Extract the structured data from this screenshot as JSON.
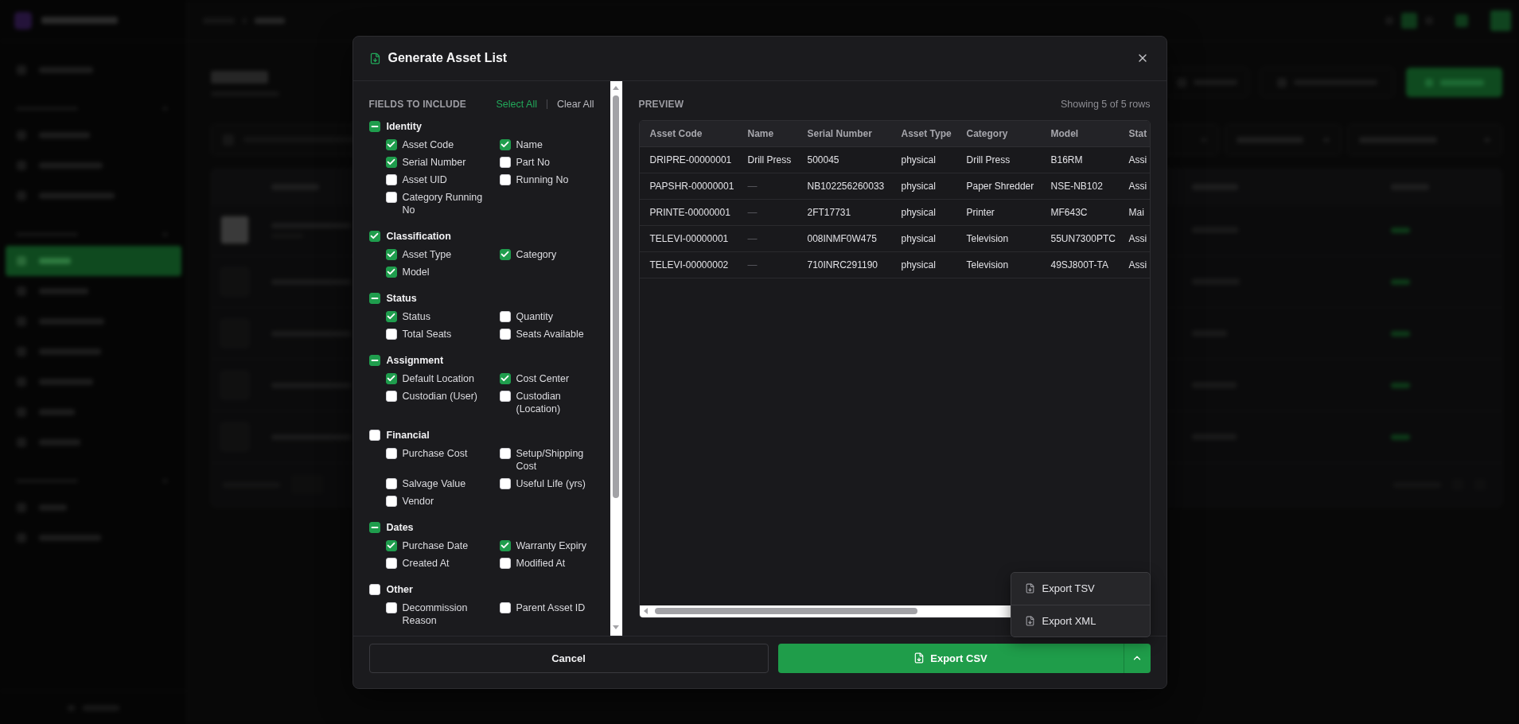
{
  "dialog": {
    "title": "Generate Asset List"
  },
  "fields_panel": {
    "heading": "FIELDS TO INCLUDE",
    "actions": [
      {
        "label": "Select All",
        "kind": "primary"
      },
      {
        "label": "Clear All",
        "kind": "secondary"
      }
    ],
    "groups": [
      {
        "label": "Identity",
        "checked": true,
        "fields": [
          {
            "label": "Asset Code",
            "checked": true
          },
          {
            "label": "Name",
            "checked": true
          },
          {
            "label": "Serial Number",
            "checked": true
          },
          {
            "label": "Part No",
            "checked": false
          },
          {
            "label": "Asset UID",
            "checked": false
          },
          {
            "label": "Running No",
            "checked": false
          },
          {
            "label": "Category Running No",
            "checked": false
          }
        ]
      },
      {
        "label": "Classification",
        "checked": true,
        "fields": [
          {
            "label": "Asset Type",
            "checked": true
          },
          {
            "label": "Category",
            "checked": true
          },
          {
            "label": "Model",
            "checked": true
          }
        ]
      },
      {
        "label": "Status",
        "checked": true,
        "fields": [
          {
            "label": "Status",
            "checked": true
          },
          {
            "label": "Quantity",
            "checked": false
          },
          {
            "label": "Total Seats",
            "checked": false
          },
          {
            "label": "Seats Available",
            "checked": false
          }
        ]
      },
      {
        "label": "Assignment",
        "checked": true,
        "fields": [
          {
            "label": "Default Location",
            "checked": true
          },
          {
            "label": "Cost Center",
            "checked": true
          },
          {
            "label": "Custodian (User)",
            "checked": false
          },
          {
            "label": "Custodian (Location)",
            "checked": false
          }
        ]
      },
      {
        "label": "Financial",
        "checked": false,
        "fields": [
          {
            "label": "Purchase Cost",
            "checked": false
          },
          {
            "label": "Setup/Shipping Cost",
            "checked": false
          },
          {
            "label": "Salvage Value",
            "checked": false
          },
          {
            "label": "Useful Life (yrs)",
            "checked": false
          },
          {
            "label": "Vendor",
            "checked": false
          }
        ]
      },
      {
        "label": "Dates",
        "checked": true,
        "fields": [
          {
            "label": "Purchase Date",
            "checked": true
          },
          {
            "label": "Warranty Expiry",
            "checked": true
          },
          {
            "label": "Created At",
            "checked": false
          },
          {
            "label": "Modified At",
            "checked": false
          }
        ]
      },
      {
        "label": "Other",
        "checked": false,
        "fields": [
          {
            "label": "Decommission Reason",
            "checked": false
          },
          {
            "label": "Parent Asset ID",
            "checked": false
          }
        ]
      }
    ]
  },
  "preview": {
    "heading": "PREVIEW",
    "row_count": "Showing 5 of 5 rows",
    "table": {
      "columns": [
        "Asset Code",
        "Name",
        "Serial Number",
        "Asset Type",
        "Category",
        "Model",
        "Stat"
      ],
      "rows": [
        [
          {
            "text": "DRIPRE-00000001",
            "muted": false
          },
          {
            "text": "Drill Press",
            "muted": false
          },
          {
            "text": "500045",
            "muted": false
          },
          {
            "text": "physical",
            "muted": false
          },
          {
            "text": "Drill Press",
            "muted": false
          },
          {
            "text": "B16RM",
            "muted": false
          },
          {
            "text": "Assi",
            "muted": false
          }
        ],
        [
          {
            "text": "PAPSHR-00000001",
            "muted": false
          },
          {
            "text": "—",
            "muted": true
          },
          {
            "text": "NB102256260033",
            "muted": false
          },
          {
            "text": "physical",
            "muted": false
          },
          {
            "text": "Paper Shredder",
            "muted": false
          },
          {
            "text": "NSE-NB102",
            "muted": false
          },
          {
            "text": "Assi",
            "muted": false
          }
        ],
        [
          {
            "text": "PRINTE-00000001",
            "muted": false
          },
          {
            "text": "—",
            "muted": true
          },
          {
            "text": "2FT17731",
            "muted": false
          },
          {
            "text": "physical",
            "muted": false
          },
          {
            "text": "Printer",
            "muted": false
          },
          {
            "text": "MF643C",
            "muted": false
          },
          {
            "text": "Mai",
            "muted": false
          }
        ],
        [
          {
            "text": "TELEVI-00000001",
            "muted": false
          },
          {
            "text": "—",
            "muted": true
          },
          {
            "text": "008INMF0W475",
            "muted": false
          },
          {
            "text": "physical",
            "muted": false
          },
          {
            "text": "Television",
            "muted": false
          },
          {
            "text": "55UN7300PTC",
            "muted": false
          },
          {
            "text": "Assi",
            "muted": false
          }
        ],
        [
          {
            "text": "TELEVI-00000002",
            "muted": false
          },
          {
            "text": "—",
            "muted": true
          },
          {
            "text": "710INRC291190",
            "muted": false
          },
          {
            "text": "physical",
            "muted": false
          },
          {
            "text": "Television",
            "muted": false
          },
          {
            "text": "49SJ800T-TA",
            "muted": false
          },
          {
            "text": "Assi",
            "muted": false
          }
        ]
      ]
    }
  },
  "export_menu": {
    "open": true,
    "items": [
      {
        "label": "Export TSV"
      },
      {
        "label": "Export XML"
      }
    ]
  },
  "footer": {
    "cancel": "Cancel",
    "export": "Export CSV"
  }
}
